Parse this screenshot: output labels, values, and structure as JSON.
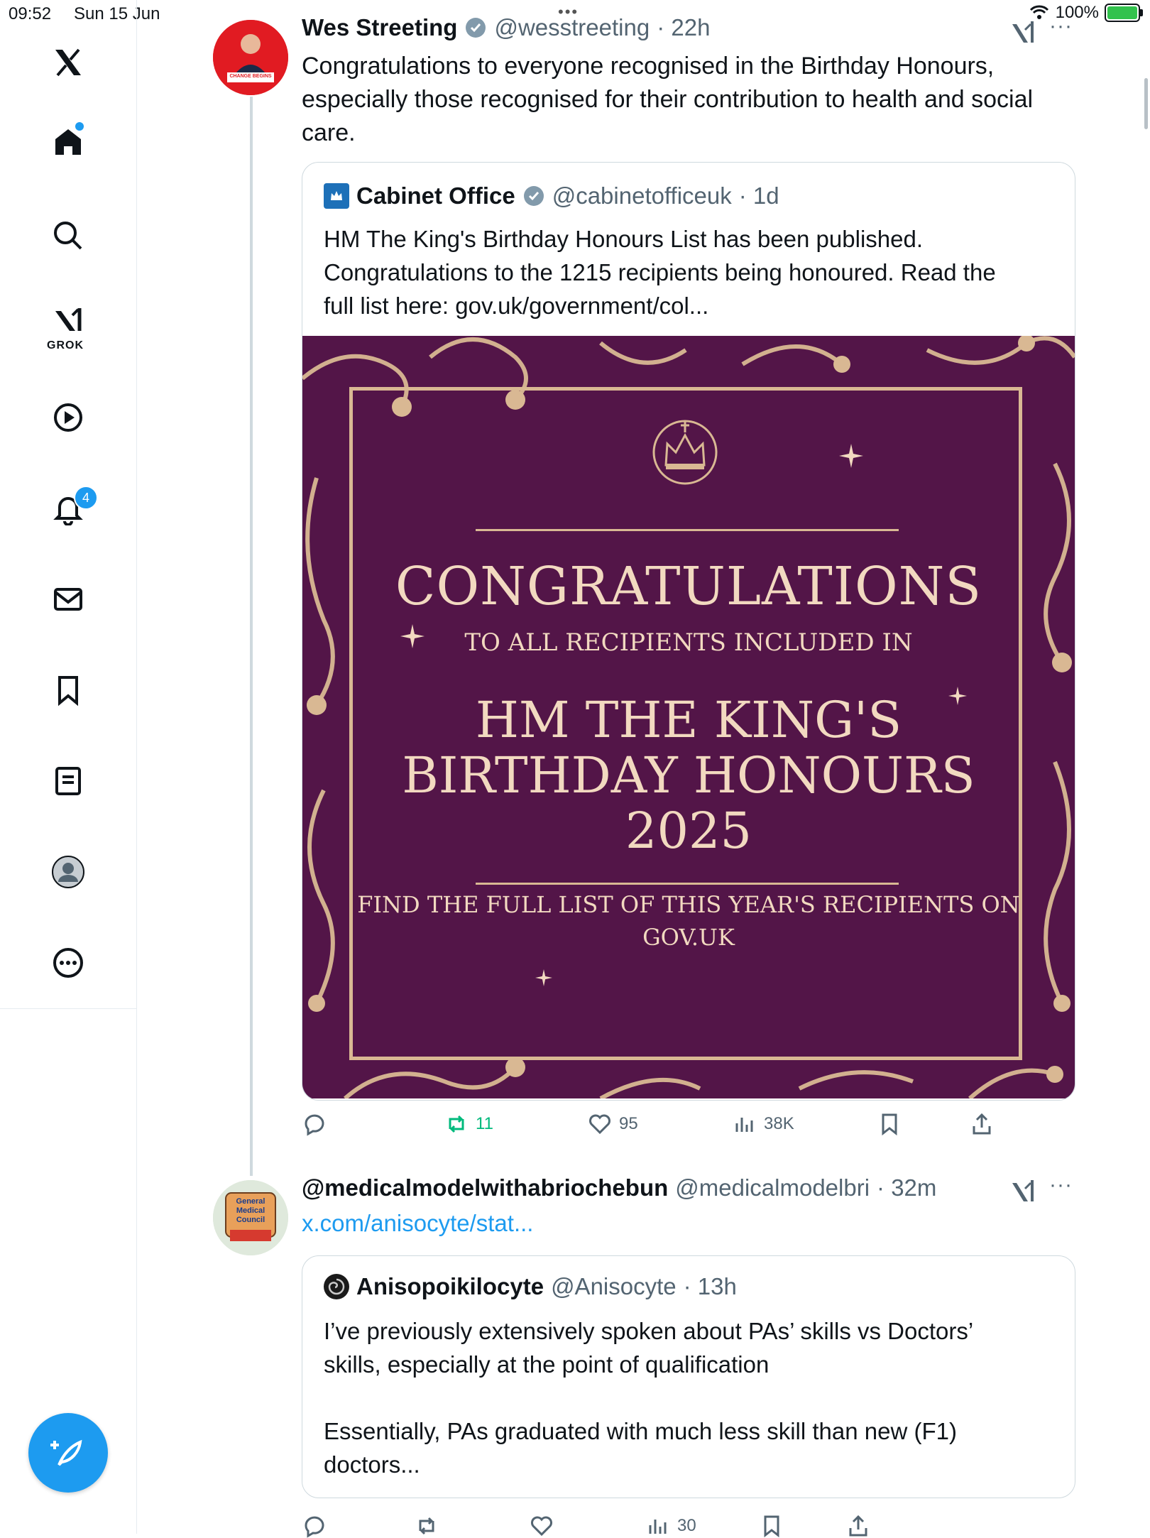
{
  "status_bar": {
    "time": "09:52",
    "date": "Sun 15 Jun",
    "battery": "100%"
  },
  "sidebar": {
    "grok_label": "GROK",
    "notifications_badge": "4"
  },
  "tweet1": {
    "author_name": "Wes Streeting",
    "author_handle": "@wesstreeting",
    "time": "· 22h",
    "text_lines": [
      "Congratulations to everyone recognised in the Birthday Honours,",
      "especially those recognised for their contribution to health and social",
      "care."
    ],
    "avatar_banner": "CHANGE BEGINS",
    "quote": {
      "author_name": "Cabinet Office",
      "author_handle": "@cabinetofficeuk",
      "time": "· 1d",
      "text_lines": [
        "HM The King's Birthday Honours List has been published.",
        "Congratulations to the 1215 recipients being honoured.  Read the",
        "full list here: gov.uk/government/col..."
      ]
    },
    "image_text": {
      "heading": "CONGRATULATIONS",
      "subheading": "TO ALL RECIPIENTS INCLUDED IN",
      "title_line1": "HM THE KING'S",
      "title_line2": "BIRTHDAY HONOURS",
      "year": "2025",
      "footer_line1": "FIND THE FULL LIST OF THIS YEAR'S RECIPIENTS ON",
      "footer_line2": "GOV.UK"
    },
    "stats": {
      "replies": "",
      "retweets": "11",
      "likes": "95",
      "views": "38K"
    }
  },
  "tweet2": {
    "author_name": "@medicalmodelwithabriochebun",
    "author_handle": "@medicalmodelbri",
    "time": "· 32m",
    "link": "x.com/anisocyte/stat...",
    "avatar_text": "General Medical Council",
    "quote": {
      "author_name": "Anisopoikilocyte",
      "author_handle": "@Anisocyte",
      "time": "· 13h",
      "para1_lines": [
        "I’ve previously extensively spoken about PAs’ skills vs Doctors’",
        "skills, especially at the point of qualification"
      ],
      "para2_lines": [
        "Essentially, PAs graduated with much less skill than new (F1)",
        "doctors..."
      ]
    },
    "stats": {
      "views": "30"
    }
  },
  "colors": {
    "accent": "#1d9bf0",
    "retweet_green": "#00ba7c",
    "honours_purple": "#531548",
    "honours_gold": "#d9b893"
  }
}
